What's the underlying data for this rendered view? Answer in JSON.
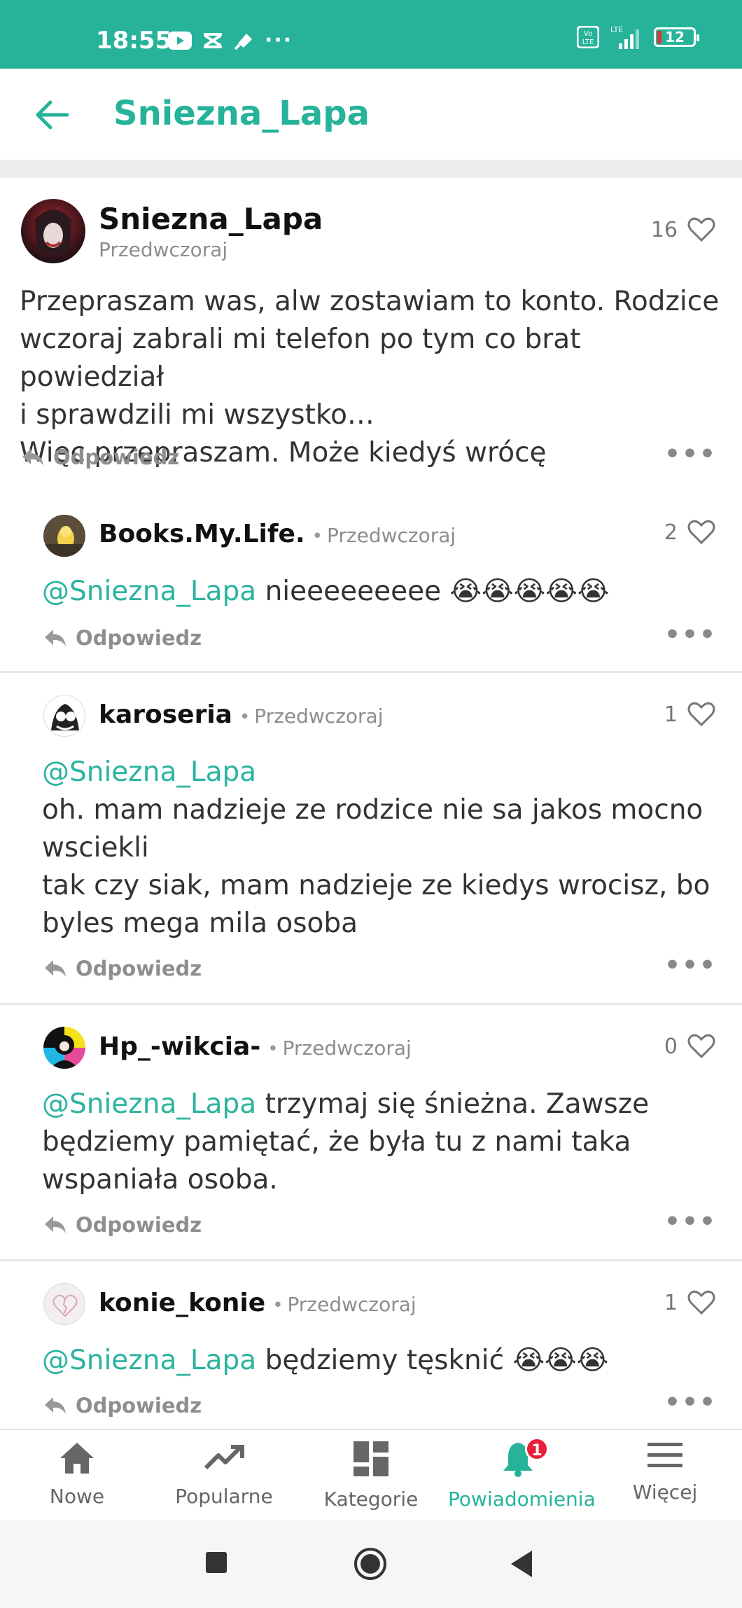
{
  "status": {
    "time": "18:55",
    "battery": "12",
    "net": "LTE"
  },
  "header": {
    "title": "Sniezna_Lapa"
  },
  "main_post": {
    "author": "Sniezna_Lapa",
    "time": "Przedwczoraj",
    "likes": "16",
    "text_lines": [
      "Przepraszam was, alw zostawiam to konto. Rodzice",
      "wczoraj zabrali mi telefon po tym co brat powiedział",
      "i sprawdzili mi wszystko…",
      "Więc przepraszam. Może kiedyś wrócę"
    ],
    "reply_label": "Odpowiedz"
  },
  "comments": [
    {
      "author": "Books.My.Life.",
      "time": "Przedwczoraj",
      "likes": "2",
      "mention": "@Sniezna_Lapa",
      "text_inline": " nieeeeeeeee 😭😭😭😭😭",
      "reply_label": "Odpowiedz"
    },
    {
      "author": "karoseria",
      "time": "Przedwczoraj",
      "likes": "1",
      "mention": "@Sniezna_Lapa",
      "lines": [
        "oh. mam nadzieje ze rodzice nie sa jakos mocno",
        "wsciekli",
        "tak czy siak, mam nadzieje ze kiedys wrocisz, bo",
        "byles mega mila osoba"
      ],
      "reply_label": "Odpowiedz"
    },
    {
      "author": "Hp_-wikcia-",
      "time": "Przedwczoraj",
      "likes": "0",
      "mention": "@Sniezna_Lapa",
      "text_inline": " trzymaj się śnieżna. Zawsze",
      "lines": [
        "będziemy pamiętać, że była tu z nami taka",
        "wspaniała osoba."
      ],
      "reply_label": "Odpowiedz"
    },
    {
      "author": "konie_konie",
      "time": "Przedwczoraj",
      "likes": "1",
      "mention": "@Sniezna_Lapa",
      "text_inline": " będziemy tęsknić 😭😭😭",
      "reply_label": "Odpowiedz"
    }
  ],
  "bottom_nav": {
    "items": [
      {
        "label": "Nowe",
        "icon": "home-icon"
      },
      {
        "label": "Popularne",
        "icon": "trending-icon"
      },
      {
        "label": "Kategorie",
        "icon": "dashboard-icon"
      },
      {
        "label": "Powiadomienia",
        "icon": "bell-icon",
        "badge": "1",
        "active": true
      },
      {
        "label": "Więcej",
        "icon": "menu-icon"
      }
    ]
  },
  "colors": {
    "accent": "#26b39a",
    "mention": "#2bb3a0",
    "badge": "#e8213a"
  }
}
